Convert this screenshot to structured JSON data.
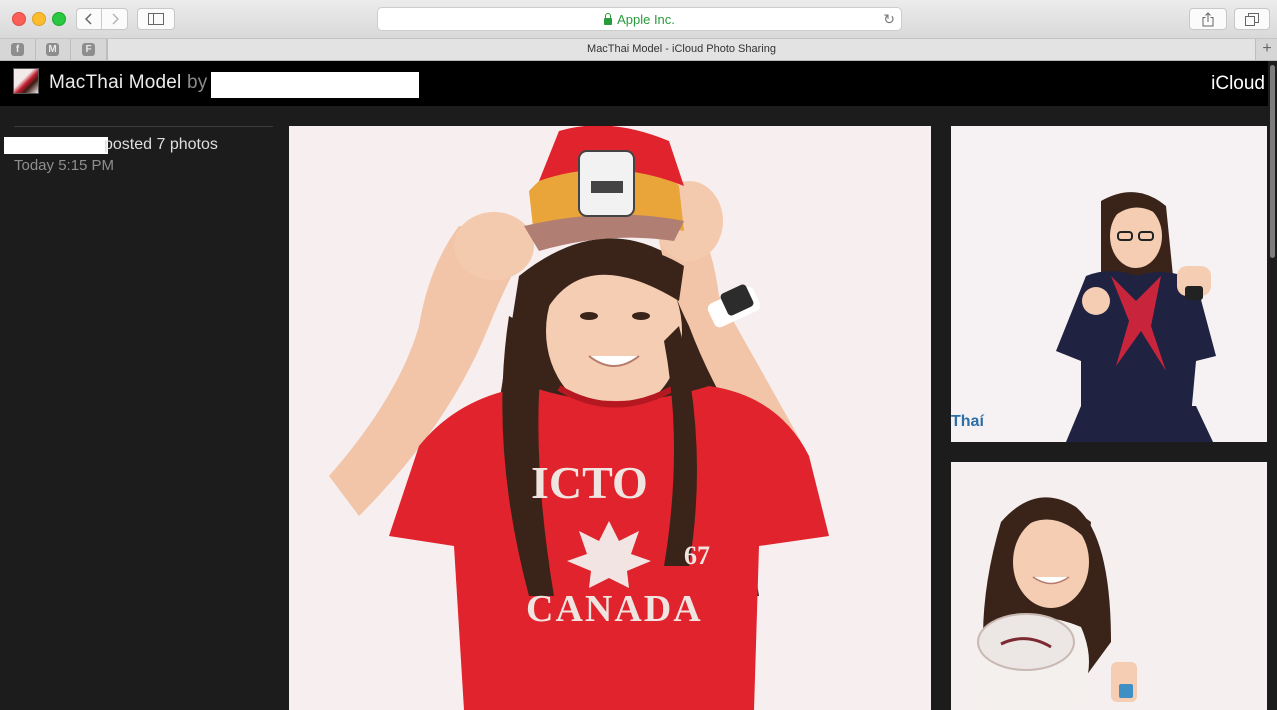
{
  "browser": {
    "url_text": "Apple Inc.",
    "tab_title": "MacThai Model - iCloud Photo Sharing",
    "favorites": [
      {
        "icon": "facebook-icon",
        "glyph": "f"
      },
      {
        "icon": "medium-icon",
        "glyph": "M"
      },
      {
        "icon": "flipboard-icon",
        "glyph": "F"
      }
    ],
    "new_tab_glyph": "+"
  },
  "header": {
    "album_title": "MacThai Model",
    "by_label": "by",
    "service": "iCloud"
  },
  "sidebar": {
    "posted_text": "posted 7 photos",
    "timestamp": "Today 5:15 PM"
  },
  "photos": {
    "main": {
      "shirt_text_1": "ICTO",
      "shirt_text_2": "CANADA",
      "shirt_digits": "67"
    },
    "side_top": {
      "watermark": "Thaí"
    }
  },
  "colors": {
    "page_bg": "#1c1c1c",
    "header_bg": "#000000",
    "url_green": "#2a9b3c",
    "shirt_red": "#e0232c"
  }
}
